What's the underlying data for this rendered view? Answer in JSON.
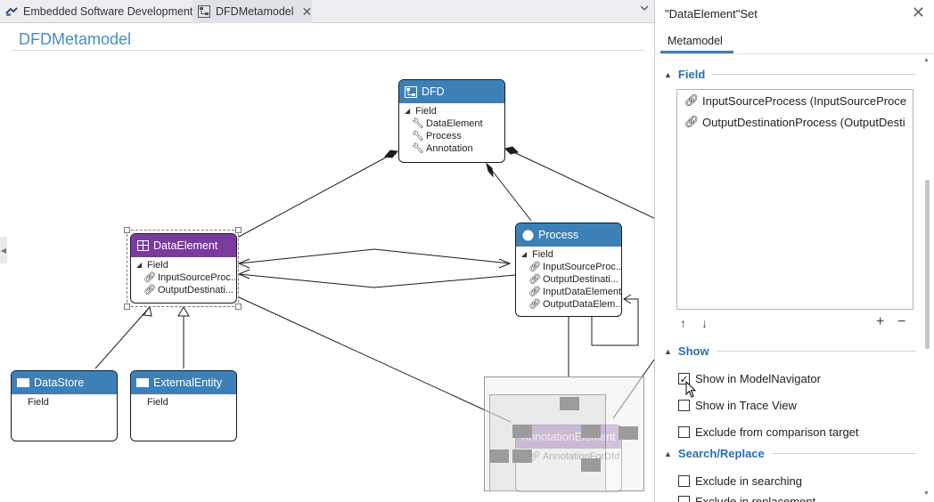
{
  "tabs": [
    {
      "label": "Embedded Software Development",
      "icon": "project-icon",
      "active": false
    },
    {
      "label": "DFDMetamodel",
      "icon": "diagram-icon",
      "active": true,
      "close": "✕"
    }
  ],
  "diagram": {
    "title": "DFDMetamodel",
    "nodes": {
      "dfd": {
        "title": "DFD",
        "group": "Field",
        "items": [
          "DataElement",
          "Process",
          "Annotation"
        ]
      },
      "data_element": {
        "title": "DataElement",
        "group": "Field",
        "items": [
          "InputSourceProc...",
          "OutputDestinati..."
        ]
      },
      "process": {
        "title": "Process",
        "group": "Field",
        "items": [
          "InputSourceProc...",
          "OutputDestinati...",
          "InputDataElement",
          "OutputDataElem..."
        ]
      },
      "data_store": {
        "title": "DataStore",
        "group": "Field"
      },
      "external_entity": {
        "title": "ExternalEntity",
        "group": "Field"
      },
      "annotation": {
        "title": "AnnotationElement",
        "item": "AnnotationForDfd"
      }
    }
  },
  "panel": {
    "title": "\"DataElement\"Set",
    "tab": "Metamodel",
    "field_section": "Field",
    "fields": [
      "InputSourceProcess (InputSourceProce",
      "OutputDestinationProcess (OutputDesti"
    ],
    "tools": {
      "up": "↑",
      "down": "↓",
      "add": "+",
      "remove": "−"
    },
    "show_section": "Show",
    "show_options": [
      {
        "label": "Show in ModelNavigator",
        "checked": true
      },
      {
        "label": "Show in Trace View",
        "checked": false
      },
      {
        "label": "Exclude from comparison target",
        "checked": false
      }
    ],
    "search_section": "Search/Replace",
    "search_options": [
      {
        "label": "Exclude in searching",
        "checked": false
      },
      {
        "label": "Exclude in replacement",
        "checked": false
      }
    ]
  },
  "colors": {
    "accent": "#3d80b8",
    "selected_node": "#7b3a9e",
    "title": "#4b8cc9"
  }
}
